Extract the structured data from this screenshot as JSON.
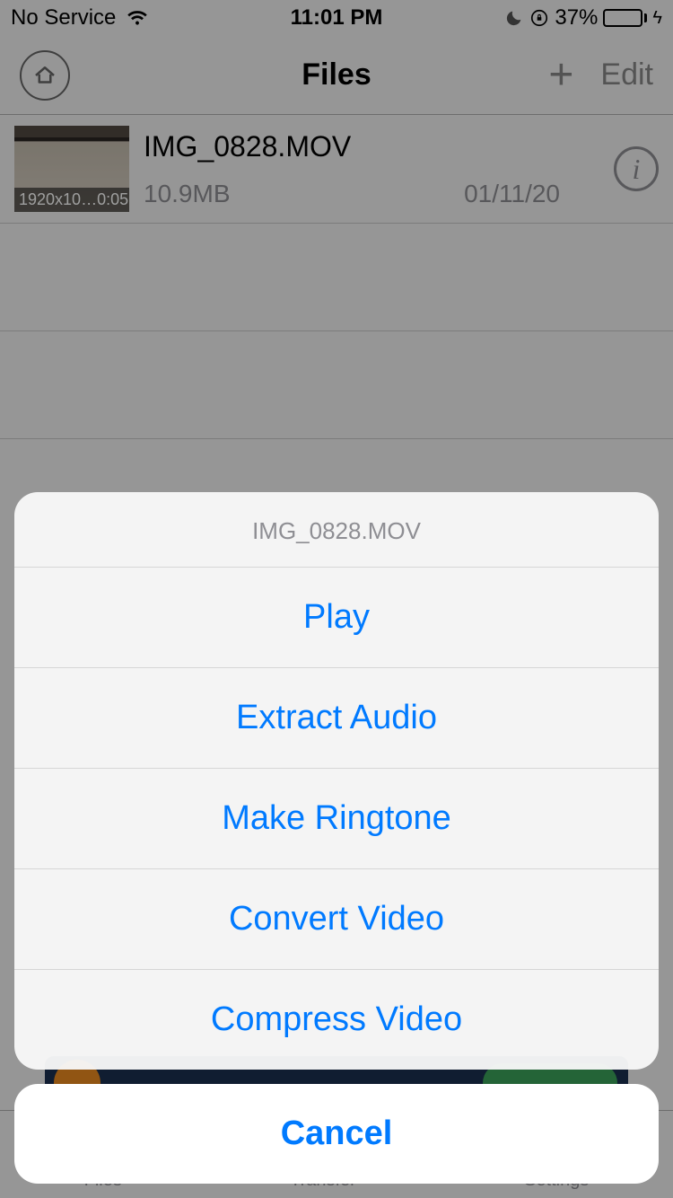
{
  "status": {
    "carrier": "No Service",
    "time": "11:01 PM",
    "battery_pct": "37%",
    "battery_fill_pct": 37
  },
  "nav": {
    "title": "Files",
    "edit_label": "Edit"
  },
  "file": {
    "name": "IMG_0828.MOV",
    "size": "10.9MB",
    "date": "01/11/20",
    "thumb_res": "1920x10…",
    "thumb_time": "0:05"
  },
  "tabs": {
    "files": "Files",
    "transfer": "Transfer",
    "settings": "Settings"
  },
  "sheet": {
    "title": "IMG_0828.MOV",
    "actions": {
      "play": "Play",
      "extract": "Extract Audio",
      "ringtone": "Make Ringtone",
      "convert": "Convert Video",
      "compress": "Compress Video"
    },
    "cancel": "Cancel"
  }
}
